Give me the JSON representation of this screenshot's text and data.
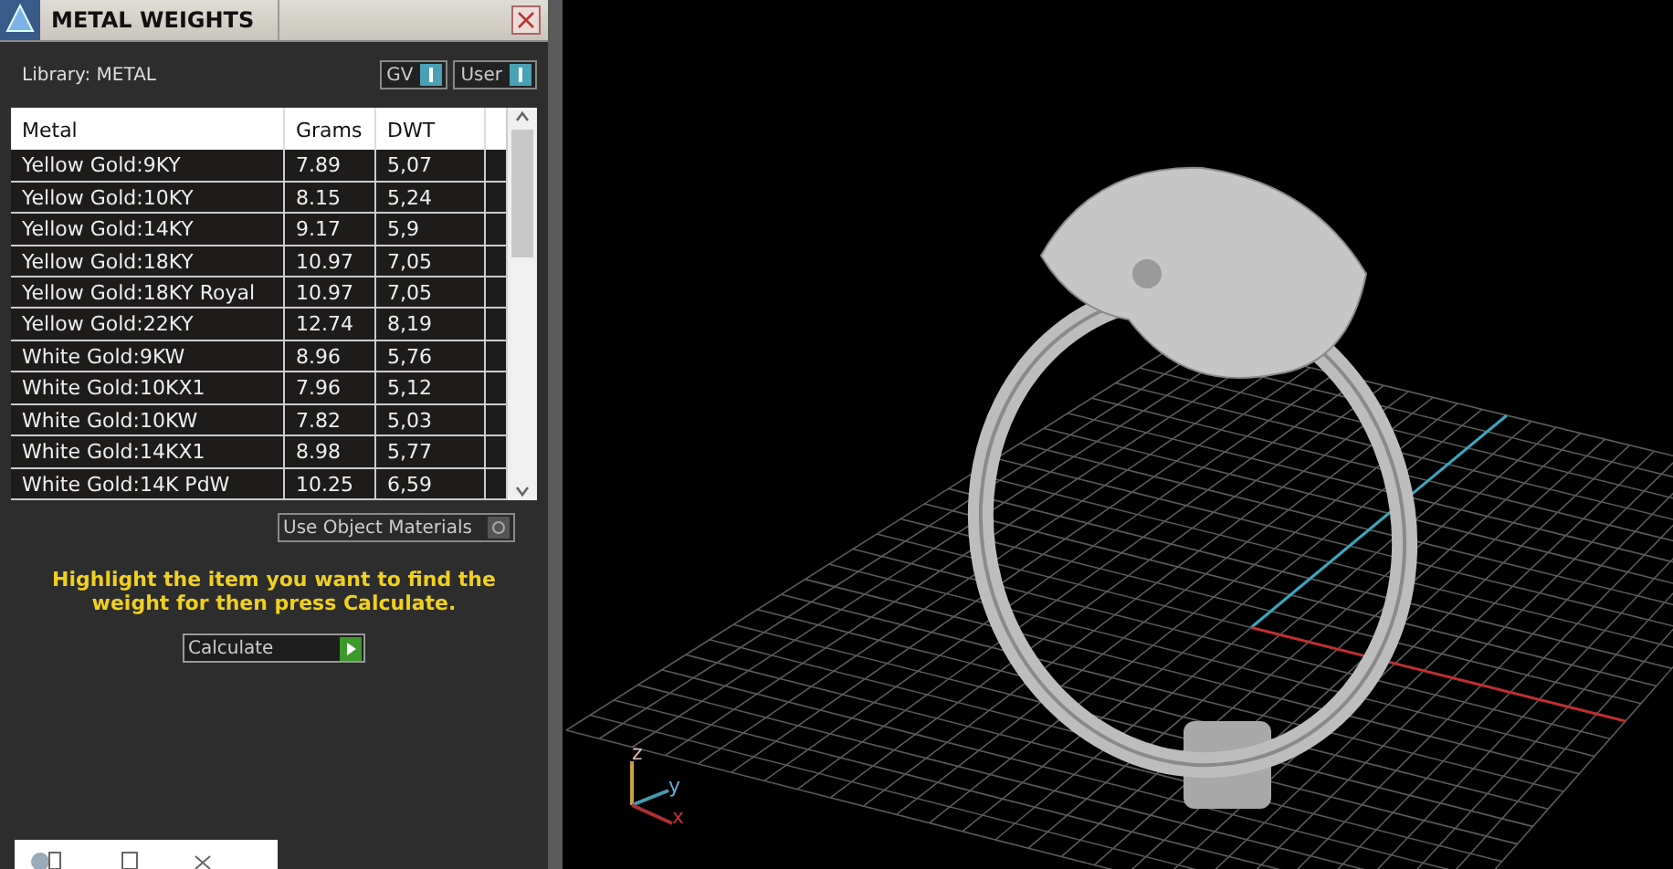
{
  "panel": {
    "title": "METAL WEIGHTS",
    "library_label": "Library: METAL",
    "toggles": [
      {
        "label": "GV"
      },
      {
        "label": "User"
      }
    ],
    "table": {
      "columns": [
        "Metal",
        "Grams",
        "DWT"
      ],
      "rows": [
        {
          "metal": "Yellow Gold:9KY",
          "grams": "7.89",
          "dwt": "5,07"
        },
        {
          "metal": "Yellow Gold:10KY",
          "grams": "8.15",
          "dwt": "5,24"
        },
        {
          "metal": "Yellow Gold:14KY",
          "grams": "9.17",
          "dwt": "5,9"
        },
        {
          "metal": "Yellow Gold:18KY",
          "grams": "10.97",
          "dwt": "7,05"
        },
        {
          "metal": "Yellow Gold:18KY Royal",
          "grams": "10.97",
          "dwt": "7,05"
        },
        {
          "metal": "Yellow Gold:22KY",
          "grams": "12.74",
          "dwt": "8,19"
        },
        {
          "metal": "White Gold:9KW",
          "grams": "8.96",
          "dwt": "5,76"
        },
        {
          "metal": "White Gold:10KX1",
          "grams": "7.96",
          "dwt": "5,12"
        },
        {
          "metal": "White Gold:10KW",
          "grams": "7.82",
          "dwt": "5,03"
        },
        {
          "metal": "White Gold:14KX1",
          "grams": "8.98",
          "dwt": "5,77"
        },
        {
          "metal": "White Gold:14K PdW",
          "grams": "10.25",
          "dwt": "6,59"
        }
      ]
    },
    "use_object_materials": {
      "label": "Use Object Materials",
      "checked": false
    },
    "instruction": "Highlight the item you want to find the weight for then press Calculate.",
    "calculate_button": "Calculate"
  },
  "viewport": {
    "axis_labels": [
      "z",
      "y",
      "x"
    ]
  }
}
